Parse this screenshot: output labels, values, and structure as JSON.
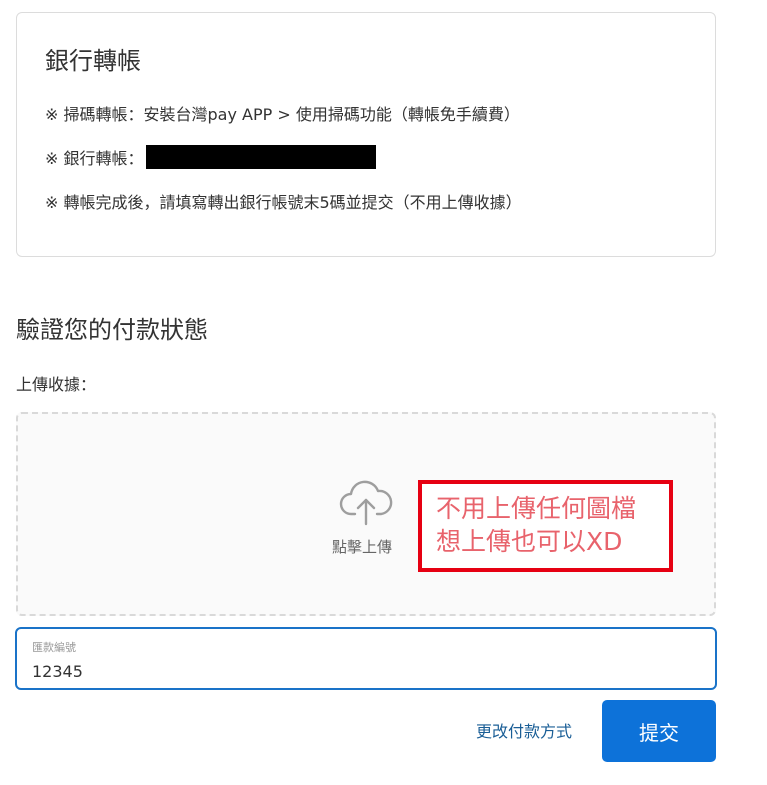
{
  "bank_transfer": {
    "title": "銀行轉帳",
    "line1": "※ 掃碼轉帳：安裝台灣pay APP > 使用掃碼功能（轉帳免手續費）",
    "line2_prefix": "※ 銀行轉帳：",
    "line3": "※ 轉帳完成後，請填寫轉出銀行帳號末5碼並提交（不用上傳收據）"
  },
  "verify": {
    "title": "驗證您的付款狀態",
    "upload_label": "上傳收據：",
    "upload_icon": "cloud-upload-icon",
    "upload_text": "點擊上傳"
  },
  "annotation": {
    "line1": "不用上傳任何圖檔",
    "line2": "想上傳也可以XD",
    "border_color": "#e60012",
    "text_color": "#e8636c"
  },
  "remittance": {
    "label": "匯款編號",
    "value": "12345"
  },
  "actions": {
    "change_method": "更改付款方式",
    "submit": "提交",
    "primary_color": "#0d72d9"
  }
}
